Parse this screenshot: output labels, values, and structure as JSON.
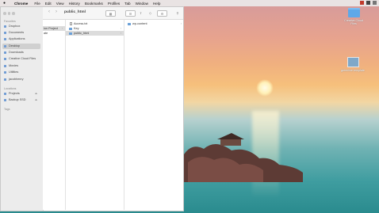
{
  "menubar": {
    "app": "Chrome",
    "items": [
      "File",
      "Edit",
      "View",
      "History",
      "Bookmarks",
      "Profiles",
      "Tab",
      "Window",
      "Help"
    ]
  },
  "finder": {
    "title": "public_html",
    "sidebar": {
      "favorites_label": "Favorites",
      "favorites": [
        "Dropbox",
        "Documents",
        "Applications",
        "Desktop",
        "Downloads",
        "Creative Cloud Files",
        "Movies",
        "Utilities",
        "jacobhenry"
      ],
      "locations_label": "Locations",
      "locations": [
        "Projects",
        "Backup SSD"
      ],
      "tags_label": "Tags"
    },
    "col1": [
      "ion Project",
      "ate"
    ],
    "col2": [
      "Access.txt",
      "Key",
      "public_html"
    ],
    "col3": [
      "wp-content"
    ]
  },
  "desktop": {
    "icons": [
      {
        "label": "Creative Cloud Files",
        "type": "folder"
      },
      {
        "label": "greenline-template",
        "type": "screenshot"
      }
    ]
  },
  "colors": {
    "folder": "#5ea8e8",
    "selection": "#dcdcdc"
  }
}
